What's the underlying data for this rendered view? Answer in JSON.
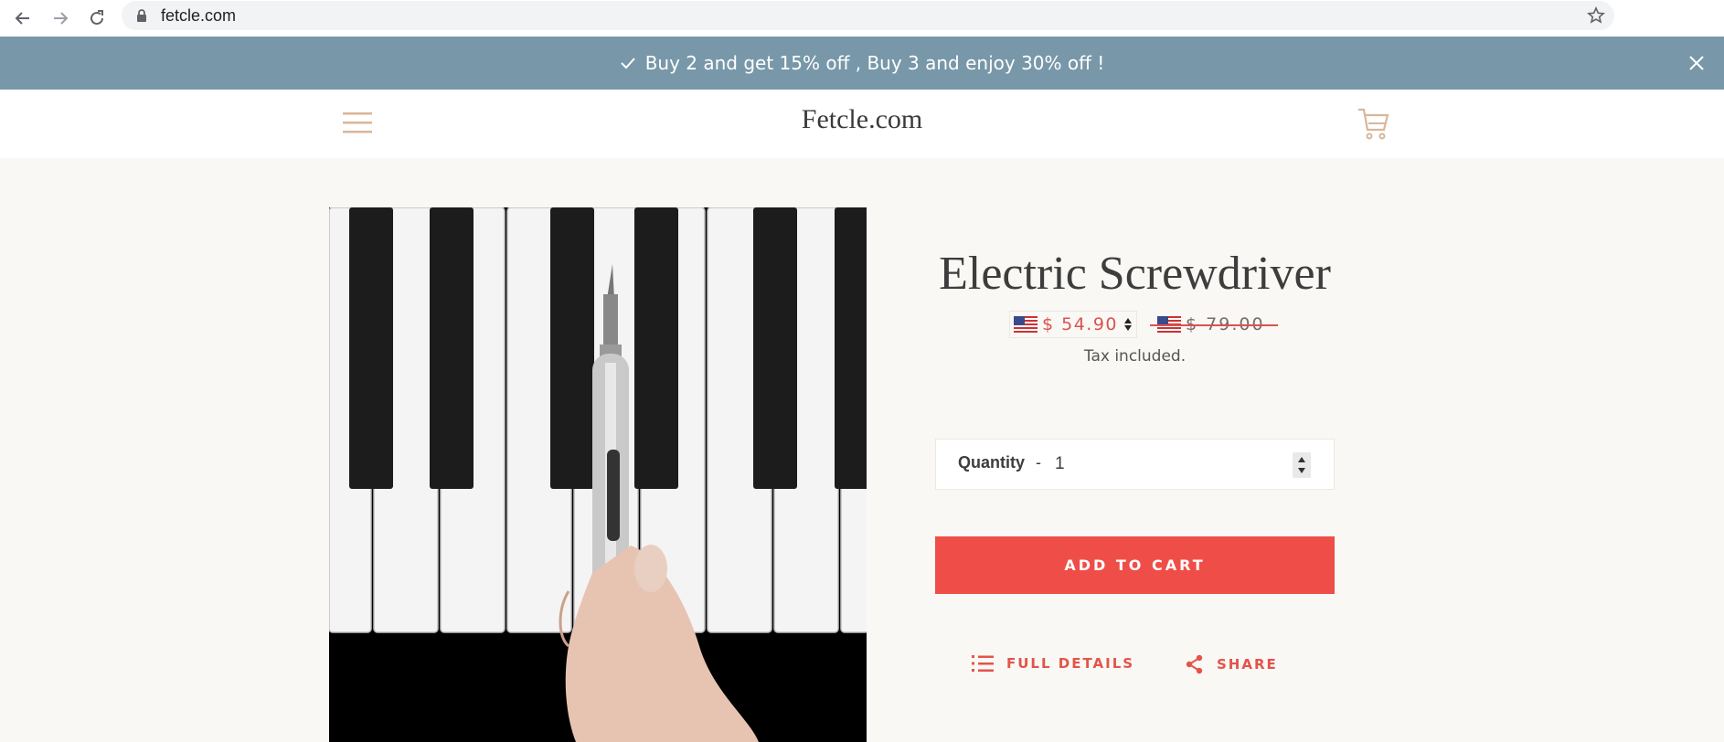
{
  "browser": {
    "url": "fetcle.com",
    "back_icon": "arrow-left-icon",
    "forward_icon": "arrow-right-icon",
    "reload_icon": "reload-icon",
    "lock_icon": "lock-icon",
    "bookmark_icon": "star-icon"
  },
  "announcement": {
    "text": "Buy 2 and get 15% off , Buy 3 and enjoy 30% off !",
    "background": "#7898a9"
  },
  "header": {
    "logo": "Fetcle.com",
    "menu_icon": "hamburger-menu-icon",
    "cart_icon": "shopping-cart-icon"
  },
  "product": {
    "title": "Electric Screwdriver",
    "price": "$ 54.90",
    "compare_price": "$ 79.00",
    "currency_flag": "us-flag-icon",
    "tax_note": "Tax included.",
    "quantity_label": "Quantity",
    "quantity_separator": "-",
    "quantity_value": "1",
    "add_to_cart": "ADD TO CART",
    "full_details": "FULL DETAILS",
    "share": "SHARE",
    "accent_color": "#ef4e48",
    "price_color": "#d9534f"
  }
}
